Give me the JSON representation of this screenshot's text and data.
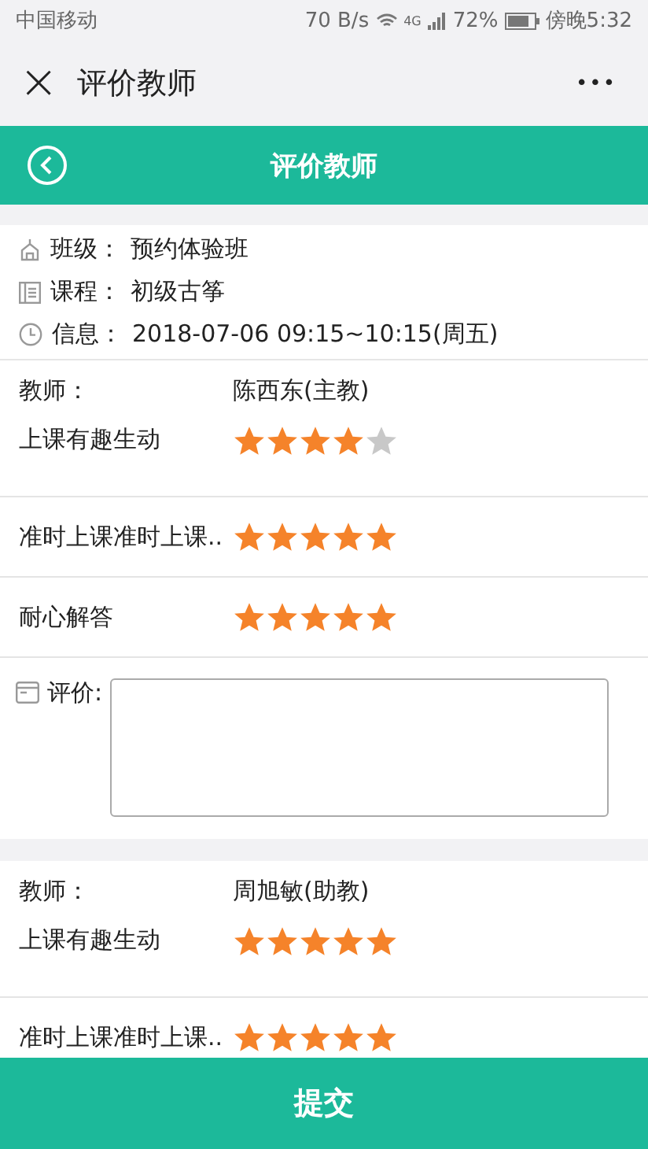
{
  "status_bar": {
    "carrier": "中国移动",
    "speed": "70 B/s",
    "network": "4G",
    "battery": "72%",
    "time": "傍晚5:32"
  },
  "window": {
    "title": "评价教师",
    "close": "×",
    "more": "•••"
  },
  "header": {
    "title": "评价教师"
  },
  "info": [
    {
      "kind": "class",
      "label": "班级：",
      "value": "预约体验班"
    },
    {
      "kind": "course",
      "label": "课程：",
      "value": "初级古筝"
    },
    {
      "kind": "time",
      "label": "信息：",
      "value": "2018-07-06 09:15~10:15(周五)"
    }
  ],
  "teachers": [
    {
      "label": "教师：",
      "name": "陈西东(主教)",
      "criteria": [
        {
          "label": "上课有趣生动",
          "stars": 4
        },
        {
          "label": "准时上课准时上课..",
          "stars": 5
        },
        {
          "label": "耐心解答",
          "stars": 5
        }
      ],
      "comment": {
        "label": "评价:"
      }
    },
    {
      "label": "教师：",
      "name": "周旭敏(助教)",
      "criteria": [
        {
          "label": "上课有趣生动",
          "stars": 5
        },
        {
          "label": "准时上课准时上课..",
          "stars": 5
        }
      ]
    }
  ],
  "submit": {
    "label": "提交"
  }
}
